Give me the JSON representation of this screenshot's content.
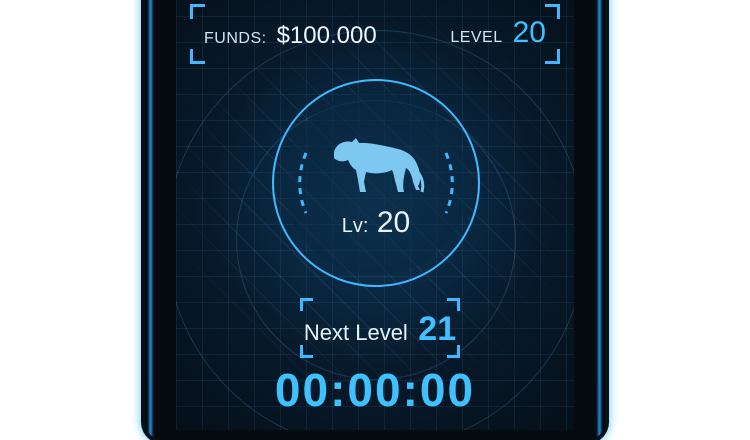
{
  "hud": {
    "funds_label": "FUNDS:",
    "funds_value": "$100.000",
    "level_label": "LEVEL",
    "level_value": "20"
  },
  "pet": {
    "icon": "panther-icon",
    "level_label": "Lv:",
    "level_value": "20"
  },
  "next_level": {
    "label": "Next Level",
    "value": "21"
  },
  "timer": {
    "value": "00:00:00"
  },
  "colors": {
    "accent": "#3fc0ff",
    "background": "#071a2b",
    "device_glow": "#33b5ff"
  }
}
